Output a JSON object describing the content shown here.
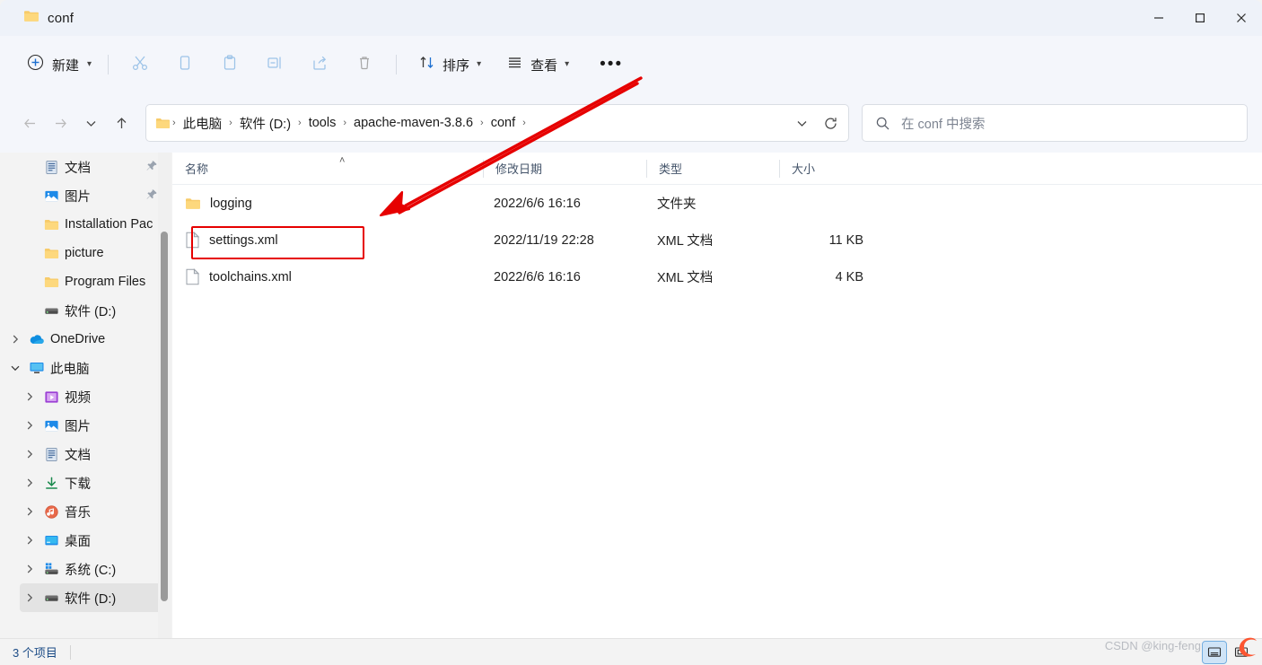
{
  "window": {
    "tab_title": "conf",
    "folder_icon": "folder-icon",
    "minimize_label": "─",
    "maximize_label": "□",
    "close_label": "✕"
  },
  "toolbar": {
    "new_label": "新建",
    "cut_label": "cut-icon",
    "copy_label": "copy-icon",
    "paste_label": "paste-icon",
    "rename_label": "rename-icon",
    "share_label": "share-icon",
    "delete_label": "delete-icon",
    "sort_label": "排序",
    "view_label": "查看",
    "more_label": "•••"
  },
  "addressbar": {
    "back_label": "←",
    "forward_label": "→",
    "recent_label": "∨",
    "up_label": "↑",
    "breadcrumbs": [
      "此电脑",
      "软件 (D:)",
      "tools",
      "apache-maven-3.8.6",
      "conf"
    ],
    "separator": "›",
    "dropdown_label": "∨",
    "refresh_label": "↻"
  },
  "search": {
    "placeholder": "在 conf 中搜索",
    "icon": "search-icon"
  },
  "sidebar": {
    "items": [
      {
        "label": "文档",
        "icon": "document-icon",
        "indent": 1,
        "expander": "",
        "pinned": true,
        "selected": false
      },
      {
        "label": "图片",
        "icon": "picture-icon",
        "indent": 1,
        "expander": "",
        "pinned": true,
        "selected": false
      },
      {
        "label": "Installation Pac",
        "icon": "folder-icon",
        "indent": 1,
        "expander": "",
        "pinned": false,
        "selected": false
      },
      {
        "label": "picture",
        "icon": "folder-icon",
        "indent": 1,
        "expander": "",
        "pinned": false,
        "selected": false
      },
      {
        "label": "Program Files",
        "icon": "folder-icon",
        "indent": 1,
        "expander": "",
        "pinned": false,
        "selected": false
      },
      {
        "label": "软件 (D:)",
        "icon": "drive-icon",
        "indent": 1,
        "expander": "",
        "pinned": false,
        "selected": false
      },
      {
        "label": "OneDrive",
        "icon": "onedrive-icon",
        "indent": 0,
        "expander": "›",
        "pinned": false,
        "selected": false
      },
      {
        "label": "此电脑",
        "icon": "pc-icon",
        "indent": 0,
        "expander": "∨",
        "pinned": false,
        "selected": false
      },
      {
        "label": "视频",
        "icon": "video-icon",
        "indent": 1,
        "expander": "›",
        "pinned": false,
        "selected": false
      },
      {
        "label": "图片",
        "icon": "picture-icon",
        "indent": 1,
        "expander": "›",
        "pinned": false,
        "selected": false
      },
      {
        "label": "文档",
        "icon": "document-icon",
        "indent": 1,
        "expander": "›",
        "pinned": false,
        "selected": false
      },
      {
        "label": "下载",
        "icon": "download-icon",
        "indent": 1,
        "expander": "›",
        "pinned": false,
        "selected": false
      },
      {
        "label": "音乐",
        "icon": "music-icon",
        "indent": 1,
        "expander": "›",
        "pinned": false,
        "selected": false
      },
      {
        "label": "桌面",
        "icon": "desktop-icon",
        "indent": 1,
        "expander": "›",
        "pinned": false,
        "selected": false
      },
      {
        "label": "系统 (C:)",
        "icon": "windows-drive-icon",
        "indent": 1,
        "expander": "›",
        "pinned": false,
        "selected": false
      },
      {
        "label": "软件 (D:)",
        "icon": "drive-icon",
        "indent": 1,
        "expander": "›",
        "pinned": false,
        "selected": true
      }
    ]
  },
  "filelist": {
    "columns": {
      "name": "名称",
      "date": "修改日期",
      "type": "类型",
      "size": "大小"
    },
    "sort_indicator": "˄",
    "rows": [
      {
        "name": "logging",
        "icon": "folder-icon",
        "date": "2022/6/6 16:16",
        "type": "文件夹",
        "size": ""
      },
      {
        "name": "settings.xml",
        "icon": "xml-file-icon",
        "date": "2022/11/19 22:28",
        "type": "XML 文档",
        "size": "11 KB"
      },
      {
        "name": "toolchains.xml",
        "icon": "xml-file-icon",
        "date": "2022/6/6 16:16",
        "type": "XML 文档",
        "size": "4 KB"
      }
    ]
  },
  "statusbar": {
    "item_count": "3 个项目",
    "details_view_label": "details-view-icon",
    "large_icons_view_label": "large-icons-view-icon"
  },
  "watermark": {
    "text": "CSDN @king-feng"
  },
  "annotation": {
    "accent_color": "#e60000",
    "highlight_target": "settings.xml"
  }
}
